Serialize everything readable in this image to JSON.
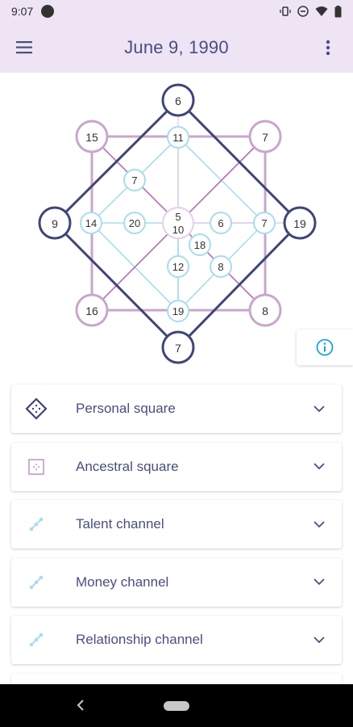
{
  "status_bar": {
    "time": "9:07"
  },
  "app_bar": {
    "title": "June 9, 1990"
  },
  "chart_nodes": {
    "top": "6",
    "left": "9",
    "right": "19",
    "bottom": "7",
    "top_left": "15",
    "top_right": "7",
    "bottom_left": "16",
    "bottom_right": "8",
    "center_top": "5",
    "center_bottom": "10",
    "inner_top": "11",
    "inner_left": "14",
    "inner_right": "7",
    "inner_bottom": "19",
    "mid_left": "20",
    "upper_left_diag": "7",
    "right_of_center": "6",
    "lower_center_a": "18",
    "lower_center_b": "12",
    "lower_right_diag": "8"
  },
  "cards": [
    {
      "label": "Personal square",
      "icon": "personal-square-icon"
    },
    {
      "label": "Ancestral square",
      "icon": "ancestral-square-icon"
    },
    {
      "label": "Talent channel",
      "icon": "channel-icon"
    },
    {
      "label": "Money channel",
      "icon": "channel-icon"
    },
    {
      "label": "Relationship channel",
      "icon": "channel-icon"
    }
  ],
  "colors": {
    "navy": "#3f4577",
    "mauve": "#c9a6cb",
    "light_blue": "#a8dcef",
    "magenta": "#b56bb6",
    "header_bg": "#eee4f3",
    "info_blue": "#1da1e0"
  }
}
